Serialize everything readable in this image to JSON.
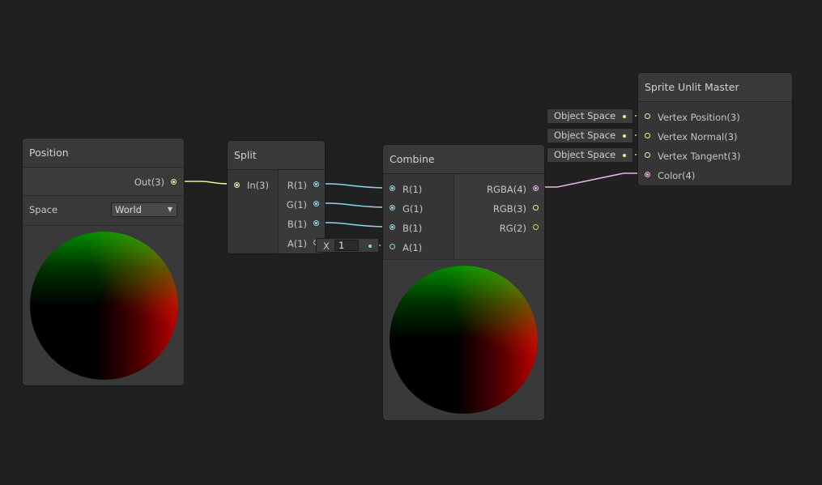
{
  "colors": {
    "background": "#202020",
    "node_bg": "#393939",
    "vector3_port": "#f0f096",
    "vector1_port": "#86d9e6",
    "vector4_port": "#e8b6e8",
    "vector2_port": "#b3e26a"
  },
  "position_node": {
    "title": "Position",
    "out_port": "Out(3)",
    "space_label": "Space",
    "space_value": "World"
  },
  "split_node": {
    "title": "Split",
    "in_port": "In(3)",
    "outputs": [
      "R(1)",
      "G(1)",
      "B(1)",
      "A(1)"
    ]
  },
  "combine_node": {
    "title": "Combine",
    "inputs": [
      "R(1)",
      "G(1)",
      "B(1)",
      "A(1)"
    ],
    "outputs": [
      "RGBA(4)",
      "RGB(3)",
      "RG(2)"
    ],
    "a_default_label": "X",
    "a_default_value": "1"
  },
  "master_node": {
    "title": "Sprite Unlit Master",
    "inputs": [
      "Vertex Position(3)",
      "Vertex Normal(3)",
      "Vertex Tangent(3)",
      "Color(4)"
    ],
    "default_pills": [
      "Object Space",
      "Object Space",
      "Object Space"
    ]
  }
}
